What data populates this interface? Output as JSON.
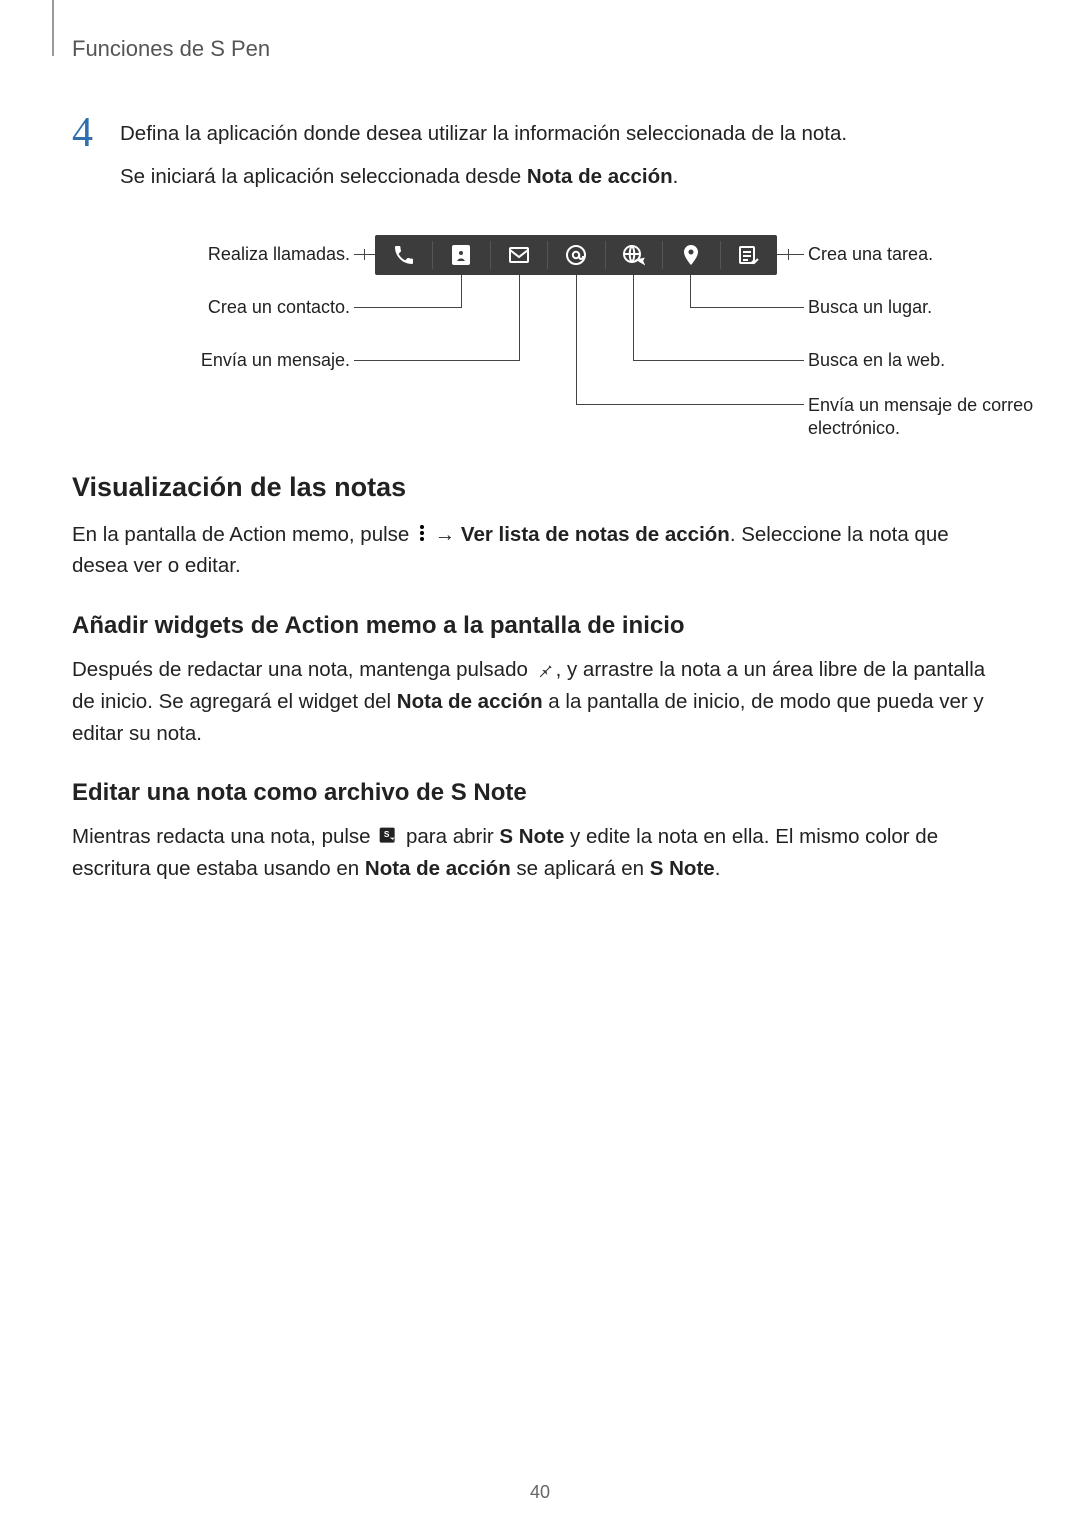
{
  "header": {
    "title": "Funciones de S Pen"
  },
  "step": {
    "number": "4",
    "line1": "Defina la aplicación donde desea utilizar la información seleccionada de la nota.",
    "line2_pre": "Se iniciará la aplicación seleccionada desde ",
    "line2_bold": "Nota de acción",
    "line2_post": "."
  },
  "diagram": {
    "left": {
      "call": "Realiza llamadas.",
      "contact": "Crea un contacto.",
      "message": "Envía un mensaje."
    },
    "right": {
      "task": "Crea una tarea.",
      "place": "Busca un lugar.",
      "web": "Busca en la web.",
      "email": "Envía un mensaje de correo electrónico."
    }
  },
  "sections": {
    "view": {
      "heading": "Visualización de las notas",
      "p_pre": "En la pantalla de Action memo, pulse ",
      "p_arrow": " → ",
      "p_bold": "Ver lista de notas de acción",
      "p_post": ". Seleccione la nota que desea ver o editar."
    },
    "widget": {
      "heading": "Añadir widgets de Action memo a la pantalla de inicio",
      "p1_pre": "Después de redactar una nota, mantenga pulsado ",
      "p1_mid": ", y arrastre la nota a un área libre de la pantalla de inicio. Se agregará el widget del ",
      "p1_bold": "Nota de acción",
      "p1_post": " a la pantalla de inicio, de modo que pueda ver y editar su nota."
    },
    "edit": {
      "heading": "Editar una nota como archivo de S Note",
      "p_pre": "Mientras redacta una nota, pulse ",
      "p_mid1": " para abrir ",
      "p_bold1": "S Note",
      "p_mid2": " y edite la nota en ella. El mismo color de escritura que estaba usando en ",
      "p_bold2": "Nota de acción",
      "p_mid3": " se aplicará en ",
      "p_bold3": "S Note",
      "p_post": "."
    }
  },
  "page_number": "40"
}
